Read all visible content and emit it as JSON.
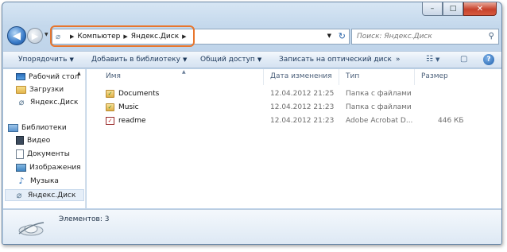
{
  "window": {
    "controls": {
      "minimize": "–",
      "maximize": "□",
      "close": "✕"
    }
  },
  "nav": {
    "back_glyph": "◀",
    "forward_glyph": "▶",
    "recent_glyph": "▼"
  },
  "address": {
    "crumbs": [
      "Компьютер",
      "Яндекс.Диск"
    ],
    "separator": "▶",
    "dropdown_glyph": "▼",
    "refresh_glyph": "↻"
  },
  "search": {
    "placeholder": "Поиск: Яндекс.Диск",
    "icon_glyph": "⚲"
  },
  "toolbar": {
    "organize": "Упорядочить",
    "add_to_library": "Добавить в библиотеку",
    "share": "Общий доступ",
    "burn": "Записать на оптический диск",
    "more": "»",
    "caret": "▼",
    "views_glyph": "☷",
    "preview_glyph": "▢",
    "help_glyph": "?"
  },
  "sidebar": {
    "items": [
      {
        "label": "Рабочий стол",
        "icon": "desktop-icon"
      },
      {
        "label": "Загрузки",
        "icon": "folder-icon"
      },
      {
        "label": "Яндекс.Диск",
        "icon": "yandex-disk-icon"
      },
      {
        "label": "Библиотеки",
        "icon": "libraries-icon"
      },
      {
        "label": "Видео",
        "icon": "video-icon"
      },
      {
        "label": "Документы",
        "icon": "documents-icon"
      },
      {
        "label": "Изображения",
        "icon": "images-icon"
      },
      {
        "label": "Музыка",
        "icon": "music-icon"
      },
      {
        "label": "Яндекс.Диск",
        "icon": "yandex-disk-icon"
      }
    ],
    "selected_index": 8
  },
  "columns": {
    "name": "Имя",
    "date": "Дата изменения",
    "type": "Тип",
    "size": "Размер",
    "sort_glyph": "▲"
  },
  "files": [
    {
      "name": "Documents",
      "date": "12.04.2012 21:25",
      "type": "Папка с файлами",
      "size": "",
      "icon": "sync-folder-icon"
    },
    {
      "name": "Music",
      "date": "12.04.2012 21:23",
      "type": "Папка с файлами",
      "size": "",
      "icon": "sync-folder-icon"
    },
    {
      "name": "readme",
      "date": "12.04.2012 21:23",
      "type": "Adobe Acrobat D...",
      "size": "446 КБ",
      "icon": "pdf-file-icon"
    }
  ],
  "details": {
    "count_label": "Элементов: 3"
  },
  "colors": {
    "accent_ring": "#e8762d",
    "toolbar_text": "#1e395b",
    "meta_text": "#6d6d6d"
  }
}
